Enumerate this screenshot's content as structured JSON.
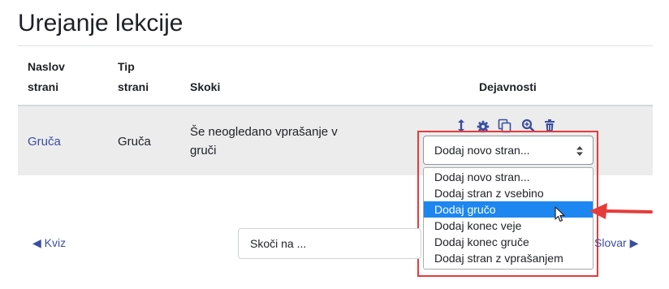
{
  "page": {
    "title": "Urejanje lekcije"
  },
  "table": {
    "headers": {
      "title_line1": "Naslov",
      "title_line2": "strani",
      "type_line1": "Tip",
      "type_line2": "strani",
      "jumps": "Skoki",
      "actions": "Dejavnosti"
    },
    "rows": [
      {
        "title": "Gruča",
        "type": "Gruča",
        "jump_line1": "Še neogledano vprašanje v",
        "jump_line2": "gruči",
        "actions": {
          "icons": [
            "move-icon",
            "gear-icon",
            "copy-icon",
            "preview-icon",
            "trash-icon"
          ],
          "select_value": "Dodaj novo stran...",
          "options": [
            "Dodaj novo stran...",
            "Dodaj stran z vsebino",
            "Dodaj gručo",
            "Dodaj konec veje",
            "Dodaj konec gruče",
            "Dodaj stran z vprašanjem"
          ],
          "hovered_option": "Dodaj gručo"
        }
      }
    ]
  },
  "navigation": {
    "prev_label": "◀ Kviz",
    "jump_placeholder": "Skoči na ...",
    "next_label": "Slovar ▶"
  },
  "colors": {
    "accent": "#3a4ea0",
    "selected_option": "#1d86f0",
    "annotation": "#e63b3b",
    "row_bg": "#ececec"
  }
}
